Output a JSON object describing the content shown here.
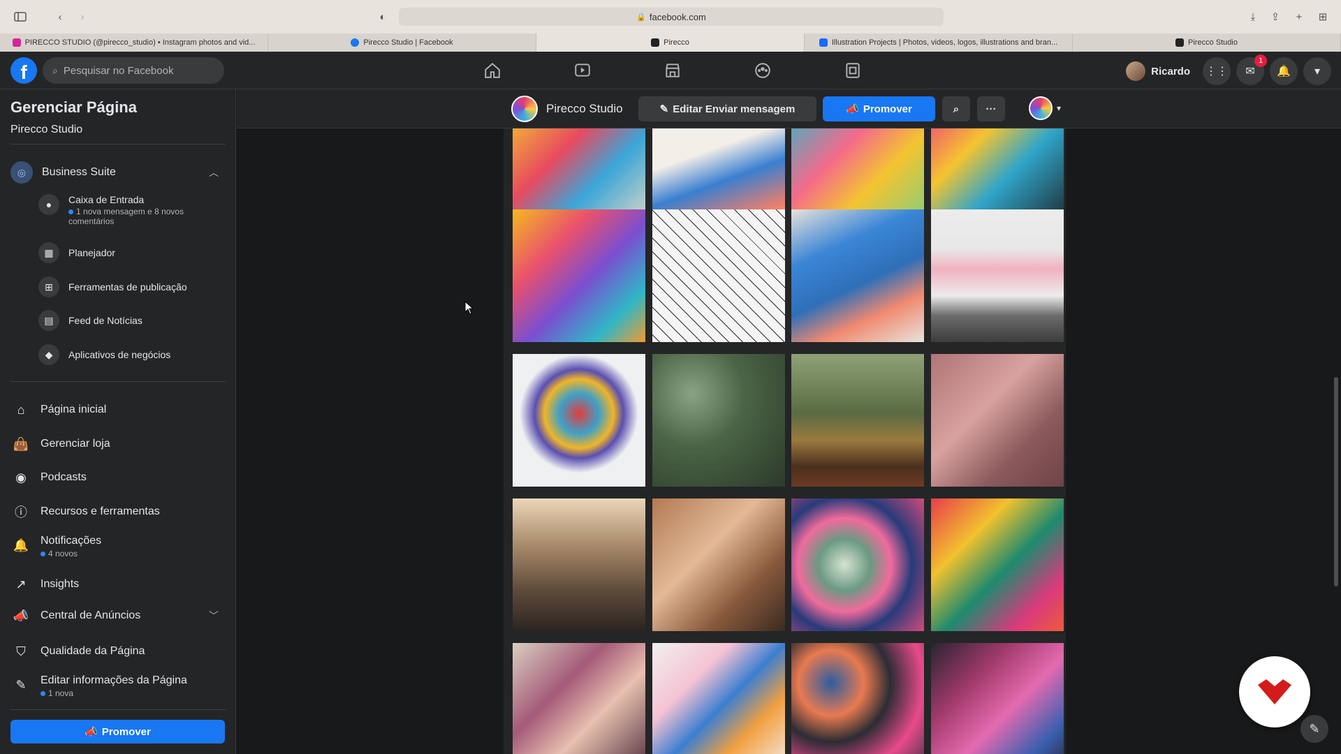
{
  "browser": {
    "url": "facebook.com",
    "tabs": [
      {
        "label": "PIRECCO STUDIO (@pirecco_studio) • Instagram photos and vid...",
        "color": "#d6249f"
      },
      {
        "label": "Pirecco Studio | Facebook",
        "color": "#1877f2"
      },
      {
        "label": "Pirecco",
        "color": "#222222"
      },
      {
        "label": "Illustration Projects | Photos, videos, logos, illustrations and bran...",
        "color": "#1769ff"
      },
      {
        "label": "Pirecco Studio",
        "color": "#222222"
      }
    ]
  },
  "fb": {
    "search_placeholder": "Pesquisar no Facebook",
    "profile_name": "Ricardo",
    "messenger_badge": "1"
  },
  "sidebar": {
    "title": "Gerenciar Página",
    "page_name": "Pirecco Studio",
    "business_suite": "Business Suite",
    "suite_items": [
      {
        "label": "Caixa de Entrada",
        "note": "1 nova mensagem e 8 novos comentários",
        "icon": "chat-icon"
      },
      {
        "label": "Planejador",
        "icon": "calendar-icon"
      },
      {
        "label": "Ferramentas de publicação",
        "icon": "publishing-tools-icon"
      },
      {
        "label": "Feed de Notícias",
        "icon": "news-feed-icon"
      },
      {
        "label": "Aplicativos de negócios",
        "icon": "cube-icon"
      }
    ],
    "main_items": [
      {
        "label": "Página inicial",
        "icon": "home-icon"
      },
      {
        "label": "Gerenciar loja",
        "icon": "shopping-bag-icon"
      },
      {
        "label": "Podcasts",
        "icon": "podcast-icon"
      },
      {
        "label": "Recursos e ferramentas",
        "icon": "info-icon"
      },
      {
        "label": "Notificações",
        "note": "4 novos",
        "icon": "bell-icon"
      },
      {
        "label": "Insights",
        "icon": "insights-icon"
      },
      {
        "label": "Central de Anúncios",
        "icon": "megaphone-icon"
      },
      {
        "label": "Qualidade da Página",
        "icon": "shield-icon"
      },
      {
        "label": "Editar informações da Página",
        "note": "1 nova",
        "icon": "pencil-icon"
      }
    ],
    "promote_label": "Promover"
  },
  "page_bar": {
    "name": "Pirecco Studio",
    "edit_label": "Editar Enviar mensagem",
    "promote_label": "Promover",
    "more_label": "···"
  },
  "photos": [
    {
      "name": "colorful-illustration-print",
      "bg": "linear-gradient(135deg,#f4c430 0%,#e84a5f 35%,#3aa6d8 60%,#f7e0c0 100%)"
    },
    {
      "name": "blue-notebook-cover",
      "bg": "linear-gradient(160deg,#f3eee8 0%,#f3eee8 35%,#3a7fd0 55%,#f07f6a 80%,#e8e3dc 100%)"
    },
    {
      "name": "colorful-pattern-book",
      "bg": "linear-gradient(135deg,#35b6c9 0%,#f46a8a 35%,#f4c430 60%,#6fd18a 100%)"
    },
    {
      "name": "colorful-pattern-dark",
      "bg": "linear-gradient(135deg,#f0437a 0%,#f4c430 30%,#30a5c9 55%,#1a1a1a 100%)"
    },
    {
      "name": "totem-illustration",
      "bg": "linear-gradient(135deg,#f5b91f 0%,#e9516c 30%,#7a4fd0 55%,#2fb7c7 80%,#f29a2e 100%)"
    },
    {
      "name": "line-art-drawing",
      "bg": "repeating-linear-gradient(45deg,#f4f4f4 0 7px,#2a2a2a 7px 8px,#f4f4f4 8px 14px)"
    },
    {
      "name": "notebook-closeup",
      "bg": "linear-gradient(155deg,#e7e2dc 0%,#3b86d6 30%,#2e6fb8 55%,#f08a70 75%,#e8e3dc 100%)"
    },
    {
      "name": "framed-print-on-wall",
      "bg": "linear-gradient(180deg,#ececec 0%,#e7e7e7 30%,#f1b1c0 45%,#ececec 65%,#6c6c6c 80%,#3d3d3d 100%)"
    },
    {
      "name": "painted-leaf",
      "bg": "radial-gradient(circle at 50% 45%,#e23c3c 0%,#3ea0c8 20%,#f0b528 35%,#5a4fb0 45%,#eef0f2 60%)"
    },
    {
      "name": "plants-with-flowers",
      "bg": "radial-gradient(circle at 30% 30%,#8aa383 0%,#4b6446 40%,#2c3a2a 100%)"
    },
    {
      "name": "plants-and-cups",
      "bg": "linear-gradient(180deg,#8fa276 0%,#5a6b43 45%,#9b7a3e 65%,#4a2f1d 85%,#6e3b23 100%)"
    },
    {
      "name": "feet-on-pink-floor",
      "bg": "linear-gradient(135deg,#b07476 0%,#d8a2a0 40%,#8b5a5c 70%,#6e4447 100%)"
    },
    {
      "name": "studio-room",
      "bg": "linear-gradient(180deg,#e9d7b8 0%,#a98a6a 35%,#5d4a3a 70%,#2c2420 100%)"
    },
    {
      "name": "brushes-on-paper",
      "bg": "linear-gradient(135deg,#b37a54 0%,#e3b997 40%,#8a5a3c 70%,#3a2a22 100%)"
    },
    {
      "name": "paint-palette",
      "bg": "radial-gradient(circle at 40% 50%,#d7e3d2 0%,#6b9a83 25%,#f06b9c 45%,#283b7a 65%,#d14b7b 100%)"
    },
    {
      "name": "paint-swatch-bright",
      "bg": "linear-gradient(135deg,#e83e4a 0%,#f2c12e 30%,#1e8a6e 55%,#d93a7c 80%,#f05a3a 100%)"
    },
    {
      "name": "paint-mix-texture",
      "bg": "linear-gradient(135deg,#d9d0c0 0%,#a45a78 35%,#e8c0b0 60%,#4a2a3a 100%)"
    },
    {
      "name": "artwork-sheet",
      "bg": "linear-gradient(135deg,#f2f0ee 0%,#f4c2d4 30%,#3c7fd0 50%,#f2a040 70%,#f2f0ee 100%)"
    },
    {
      "name": "paint-cups-tray",
      "bg": "radial-gradient(circle at 30% 30%,#2d5da0 0%,#e87a50 25%,#2c2c34 45%,#e84a8a 70%,#303040 100%)"
    },
    {
      "name": "paint-jars",
      "bg": "linear-gradient(135deg,#2a2432 0%,#a03a6a 30%,#e46ab0 55%,#3a60b0 80%,#2a2432 100%)"
    }
  ]
}
